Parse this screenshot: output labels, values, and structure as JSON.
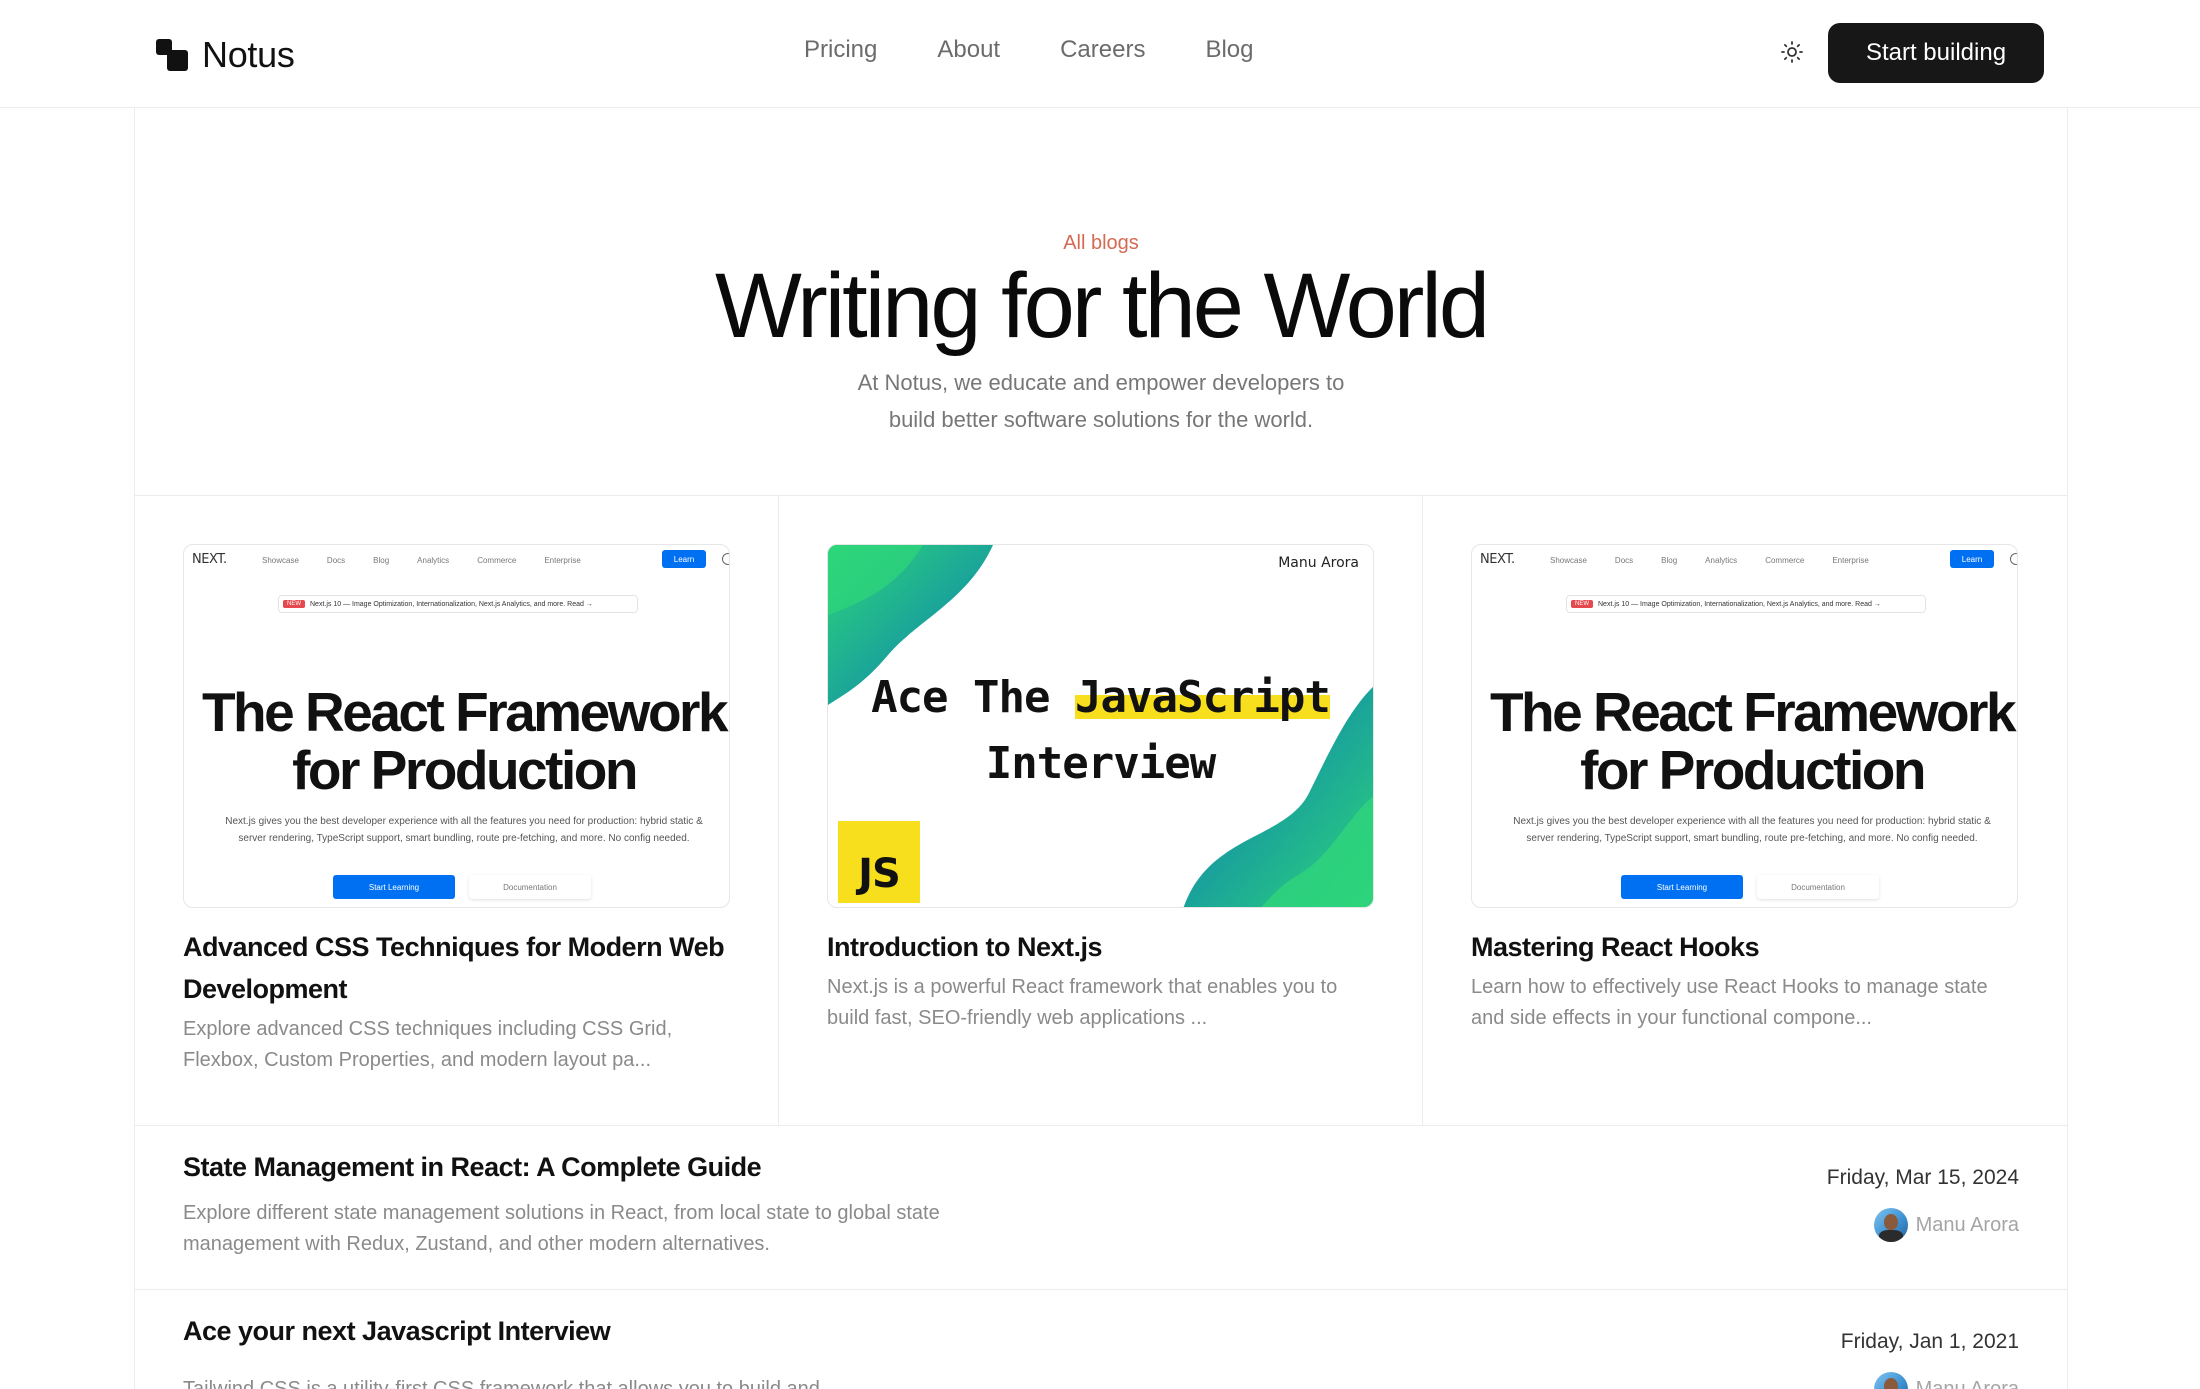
{
  "nav": {
    "brand": "Notus",
    "links": [
      "Pricing",
      "About",
      "Careers",
      "Blog"
    ],
    "theme_icon": "sun-icon",
    "cta": "Start building"
  },
  "hero": {
    "eyebrow": "All blogs",
    "title": "Writing for the World",
    "subtitle_line1": "At Notus, we educate and empower developers to",
    "subtitle_line2": "build better software solutions for the world."
  },
  "cards": [
    {
      "title": "Advanced CSS Techniques for Modern Web Development",
      "description": "Explore advanced CSS techniques including CSS Grid, Flexbox, Custom Properties, and modern layout pa...",
      "thumb": {
        "logo": "NEXT.",
        "menu": [
          "Showcase",
          "Docs",
          "Blog",
          "Analytics",
          "Commerce",
          "Enterprise"
        ],
        "learn": "Learn",
        "badge": "NEW",
        "pill": "Next.js 10 — Image Optimization, Internationalization, Next.js Analytics, and more. Read →",
        "headline_1": "The React Framework",
        "headline_2": "for Production",
        "para_1": "Next.js gives you the best developer experience with all the features you need for production: hybrid static &",
        "para_2": "server rendering, TypeScript support, smart bundling, route pre-fetching, and more. No config needed.",
        "btn_primary": "Start Learning",
        "btn_secondary": "Documentation"
      }
    },
    {
      "title": "Introduction to Next.js",
      "description": "Next.js is a powerful React framework that enables you to build fast, SEO-friendly web applications ...",
      "thumb": {
        "author": "Manu Arora",
        "line1_a": "Ace The ",
        "line1_b": "JavaScript",
        "line2": "Interview",
        "badge": "JS"
      }
    },
    {
      "title": "Mastering React Hooks",
      "description": "Learn how to effectively use React Hooks to manage state and side effects in your functional compone...",
      "thumb": {
        "logo": "NEXT.",
        "menu": [
          "Showcase",
          "Docs",
          "Blog",
          "Analytics",
          "Commerce",
          "Enterprise"
        ],
        "learn": "Learn",
        "badge": "NEW",
        "pill": "Next.js 10 — Image Optimization, Internationalization, Next.js Analytics, and more. Read →",
        "headline_1": "The React Framework",
        "headline_2": "for Production",
        "para_1": "Next.js gives you the best developer experience with all the features you need for production: hybrid static &",
        "para_2": "server rendering, TypeScript support, smart bundling, route pre-fetching, and more. No config needed.",
        "btn_primary": "Start Learning",
        "btn_secondary": "Documentation"
      }
    }
  ],
  "list": [
    {
      "title": "State Management in React: A Complete Guide",
      "description": "Explore different state management solutions in React, from local state to global state management with Redux, Zustand, and other modern alternatives.",
      "date": "Friday, Mar 15, 2024",
      "author": "Manu Arora"
    },
    {
      "title": "Ace your next Javascript Interview",
      "description": "Tailwind CSS is a utility-first CSS framework that allows you to build and",
      "date": "Friday, Jan 1, 2021",
      "author": "Manu Arora"
    }
  ],
  "colors": {
    "accent": "#d46a52",
    "cta_bg": "#171717",
    "next_blue": "#0070f3",
    "js_yellow": "#f7df1e"
  }
}
